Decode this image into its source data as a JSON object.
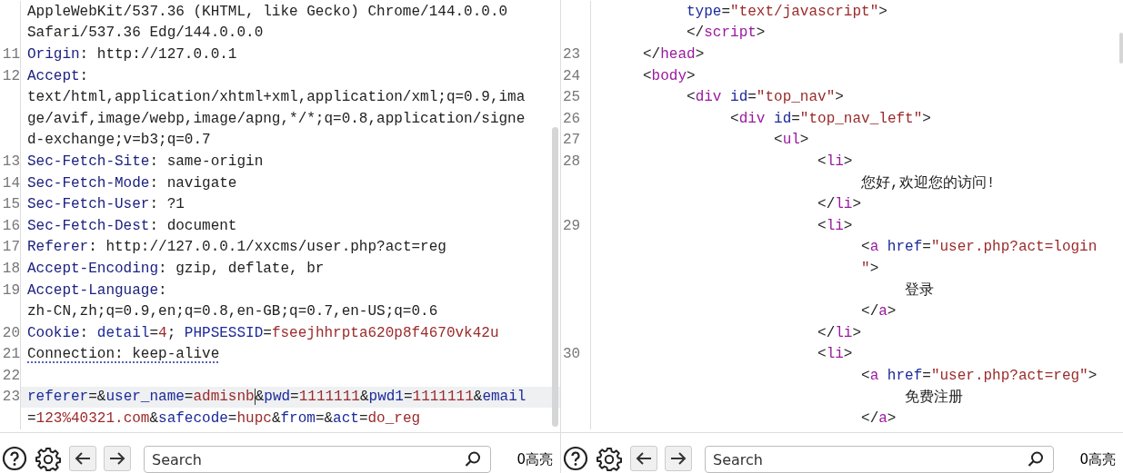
{
  "panes": [
    {
      "rows": [
        {
          "number": "",
          "current": false,
          "tokens": [
            {
              "kind": "plain",
              "text": "AppleWebKit/537.36 (KHTML, like Gecko) Chrome/144.0.0.0"
            }
          ]
        },
        {
          "number": "",
          "current": false,
          "tokens": [
            {
              "kind": "plain",
              "text": "Safari/537.36 Edg/144.0.0.0"
            }
          ]
        },
        {
          "number": "11",
          "current": false,
          "tokens": [
            {
              "kind": "name",
              "text": "Origin"
            },
            {
              "kind": "plain",
              "text": ": http://127.0.0.1"
            }
          ]
        },
        {
          "number": "12",
          "current": false,
          "tokens": [
            {
              "kind": "name",
              "text": "Accept"
            },
            {
              "kind": "plain",
              "text": ":"
            }
          ]
        },
        {
          "number": "",
          "current": false,
          "tokens": [
            {
              "kind": "plain",
              "text": "text/html,application/xhtml+xml,application/xml;q=0.9,ima"
            }
          ]
        },
        {
          "number": "",
          "current": false,
          "tokens": [
            {
              "kind": "plain",
              "text": "ge/avif,image/webp,image/apng,*/*;q=0.8,application/signe"
            }
          ]
        },
        {
          "number": "",
          "current": false,
          "tokens": [
            {
              "kind": "plain",
              "text": "d-exchange;v=b3;q=0.7"
            }
          ]
        },
        {
          "number": "13",
          "current": false,
          "tokens": [
            {
              "kind": "name",
              "text": "Sec-Fetch-Site"
            },
            {
              "kind": "plain",
              "text": ": same-origin"
            }
          ]
        },
        {
          "number": "14",
          "current": false,
          "tokens": [
            {
              "kind": "name",
              "text": "Sec-Fetch-Mode"
            },
            {
              "kind": "plain",
              "text": ": navigate"
            }
          ]
        },
        {
          "number": "15",
          "current": false,
          "tokens": [
            {
              "kind": "name",
              "text": "Sec-Fetch-User"
            },
            {
              "kind": "plain",
              "text": ": ?1"
            }
          ]
        },
        {
          "number": "16",
          "current": false,
          "tokens": [
            {
              "kind": "name",
              "text": "Sec-Fetch-Dest"
            },
            {
              "kind": "plain",
              "text": ": document"
            }
          ]
        },
        {
          "number": "17",
          "current": false,
          "tokens": [
            {
              "kind": "name",
              "text": "Referer"
            },
            {
              "kind": "plain",
              "text": ": http://127.0.0.1/xxcms/user.php?act=reg"
            }
          ]
        },
        {
          "number": "18",
          "current": false,
          "tokens": [
            {
              "kind": "name",
              "text": "Accept-Encoding"
            },
            {
              "kind": "plain",
              "text": ": gzip, deflate, br"
            }
          ]
        },
        {
          "number": "19",
          "current": false,
          "tokens": [
            {
              "kind": "name",
              "text": "Accept-Language"
            },
            {
              "kind": "plain",
              "text": ":"
            }
          ]
        },
        {
          "number": "",
          "current": false,
          "tokens": [
            {
              "kind": "plain",
              "text": "zh-CN,zh;q=0.9,en;q=0.8,en-GB;q=0.7,en-US;q=0.6"
            }
          ]
        },
        {
          "number": "20",
          "current": false,
          "tokens": [
            {
              "kind": "name",
              "text": "Cookie"
            },
            {
              "kind": "plain",
              "text": ": "
            },
            {
              "kind": "attr",
              "text": "detail"
            },
            {
              "kind": "plain",
              "text": "="
            },
            {
              "kind": "value",
              "text": "4"
            },
            {
              "kind": "plain",
              "text": "; "
            },
            {
              "kind": "attr",
              "text": "PHPSESSID"
            },
            {
              "kind": "plain",
              "text": "="
            },
            {
              "kind": "value",
              "text": "fseejhhrpta620p8f4670vk42u"
            }
          ]
        },
        {
          "number": "21",
          "current": false,
          "tokens": [
            {
              "kind": "warn",
              "text": "Connection: keep-alive"
            }
          ]
        },
        {
          "number": "22",
          "current": false,
          "tokens": []
        },
        {
          "number": "23",
          "current": true,
          "tokens": [
            {
              "kind": "attr",
              "text": "referer"
            },
            {
              "kind": "plain",
              "text": "=&"
            },
            {
              "kind": "attr",
              "text": "user_name"
            },
            {
              "kind": "plain",
              "text": "="
            },
            {
              "kind": "value",
              "text": "admisnb"
            },
            {
              "kind": "caret"
            },
            {
              "kind": "plain",
              "text": "&"
            },
            {
              "kind": "attr",
              "text": "pwd"
            },
            {
              "kind": "plain",
              "text": "="
            },
            {
              "kind": "value",
              "text": "1111111"
            },
            {
              "kind": "plain",
              "text": "&"
            },
            {
              "kind": "attr",
              "text": "pwd1"
            },
            {
              "kind": "plain",
              "text": "="
            },
            {
              "kind": "value",
              "text": "1111111"
            },
            {
              "kind": "plain",
              "text": "&"
            },
            {
              "kind": "attr",
              "text": "email"
            }
          ]
        },
        {
          "number": "",
          "current": false,
          "tokens": [
            {
              "kind": "plain",
              "text": "="
            },
            {
              "kind": "value",
              "text": "123%40321.com"
            },
            {
              "kind": "plain",
              "text": "&"
            },
            {
              "kind": "attr",
              "text": "safecode"
            },
            {
              "kind": "plain",
              "text": "="
            },
            {
              "kind": "value",
              "text": "hupc"
            },
            {
              "kind": "plain",
              "text": "&"
            },
            {
              "kind": "attr",
              "text": "from"
            },
            {
              "kind": "plain",
              "text": "=&"
            },
            {
              "kind": "attr",
              "text": "act"
            },
            {
              "kind": "plain",
              "text": "="
            },
            {
              "kind": "value",
              "text": "do_reg"
            }
          ]
        }
      ],
      "footer": {
        "search_placeholder": "Search",
        "highlights": "0高亮"
      }
    },
    {
      "rows": [
        {
          "number": "",
          "current": false,
          "tokens": [
            {
              "kind": "attr",
              "text": "          type"
            },
            {
              "kind": "plain",
              "text": "="
            },
            {
              "kind": "value",
              "text": "\"text/javascript\""
            },
            {
              "kind": "plain",
              "text": ">"
            }
          ]
        },
        {
          "number": "",
          "current": false,
          "tokens": [
            {
              "kind": "plain",
              "text": "          </"
            },
            {
              "kind": "tag",
              "text": "script"
            },
            {
              "kind": "plain",
              "text": ">"
            }
          ]
        },
        {
          "number": "23",
          "current": false,
          "tokens": [
            {
              "kind": "plain",
              "text": "     </"
            },
            {
              "kind": "tag",
              "text": "head"
            },
            {
              "kind": "plain",
              "text": ">"
            }
          ]
        },
        {
          "number": "24",
          "current": false,
          "tokens": [
            {
              "kind": "plain",
              "text": "     <"
            },
            {
              "kind": "tag",
              "text": "body"
            },
            {
              "kind": "plain",
              "text": ">"
            }
          ]
        },
        {
          "number": "25",
          "current": false,
          "tokens": [
            {
              "kind": "plain",
              "text": "          <"
            },
            {
              "kind": "tag",
              "text": "div"
            },
            {
              "kind": "attr",
              "text": " id"
            },
            {
              "kind": "plain",
              "text": "="
            },
            {
              "kind": "value",
              "text": "\"top_nav\""
            },
            {
              "kind": "plain",
              "text": ">"
            }
          ]
        },
        {
          "number": "26",
          "current": false,
          "tokens": [
            {
              "kind": "plain",
              "text": "               <"
            },
            {
              "kind": "tag",
              "text": "div"
            },
            {
              "kind": "attr",
              "text": " id"
            },
            {
              "kind": "plain",
              "text": "="
            },
            {
              "kind": "value",
              "text": "\"top_nav_left\""
            },
            {
              "kind": "plain",
              "text": ">"
            }
          ]
        },
        {
          "number": "27",
          "current": false,
          "tokens": [
            {
              "kind": "plain",
              "text": "                    <"
            },
            {
              "kind": "tag",
              "text": "ul"
            },
            {
              "kind": "plain",
              "text": ">"
            }
          ]
        },
        {
          "number": "28",
          "current": false,
          "tokens": [
            {
              "kind": "plain",
              "text": "                         <"
            },
            {
              "kind": "tag",
              "text": "li"
            },
            {
              "kind": "plain",
              "text": ">"
            }
          ]
        },
        {
          "number": "",
          "current": false,
          "tokens": [
            {
              "kind": "plain",
              "text": "                              您好,欢迎您的访问!"
            }
          ]
        },
        {
          "number": "",
          "current": false,
          "tokens": [
            {
              "kind": "plain",
              "text": "                         </"
            },
            {
              "kind": "tag",
              "text": "li"
            },
            {
              "kind": "plain",
              "text": ">"
            }
          ]
        },
        {
          "number": "29",
          "current": false,
          "tokens": [
            {
              "kind": "plain",
              "text": "                         <"
            },
            {
              "kind": "tag",
              "text": "li"
            },
            {
              "kind": "plain",
              "text": ">"
            }
          ]
        },
        {
          "number": "",
          "current": false,
          "tokens": [
            {
              "kind": "plain",
              "text": "                              <"
            },
            {
              "kind": "tag",
              "text": "a"
            },
            {
              "kind": "attr",
              "text": " href"
            },
            {
              "kind": "plain",
              "text": "="
            },
            {
              "kind": "value",
              "text": "\"user.php?act=login"
            }
          ]
        },
        {
          "number": "",
          "current": false,
          "tokens": [
            {
              "kind": "value",
              "text": "                              \""
            },
            {
              "kind": "plain",
              "text": ">"
            }
          ]
        },
        {
          "number": "",
          "current": false,
          "tokens": [
            {
              "kind": "plain",
              "text": "                                   登录"
            }
          ]
        },
        {
          "number": "",
          "current": false,
          "tokens": [
            {
              "kind": "plain",
              "text": "                              </"
            },
            {
              "kind": "tag",
              "text": "a"
            },
            {
              "kind": "plain",
              "text": ">"
            }
          ]
        },
        {
          "number": "",
          "current": false,
          "tokens": [
            {
              "kind": "plain",
              "text": "                         </"
            },
            {
              "kind": "tag",
              "text": "li"
            },
            {
              "kind": "plain",
              "text": ">"
            }
          ]
        },
        {
          "number": "30",
          "current": false,
          "tokens": [
            {
              "kind": "plain",
              "text": "                         <"
            },
            {
              "kind": "tag",
              "text": "li"
            },
            {
              "kind": "plain",
              "text": ">"
            }
          ]
        },
        {
          "number": "",
          "current": false,
          "tokens": [
            {
              "kind": "plain",
              "text": "                              <"
            },
            {
              "kind": "tag",
              "text": "a"
            },
            {
              "kind": "attr",
              "text": " href"
            },
            {
              "kind": "plain",
              "text": "="
            },
            {
              "kind": "value",
              "text": "\"user.php?act=reg\""
            },
            {
              "kind": "plain",
              "text": ">"
            }
          ]
        },
        {
          "number": "",
          "current": false,
          "tokens": [
            {
              "kind": "plain",
              "text": "                                   免费注册"
            }
          ]
        },
        {
          "number": "",
          "current": false,
          "tokens": [
            {
              "kind": "plain",
              "text": "                              </"
            },
            {
              "kind": "tag",
              "text": "a"
            },
            {
              "kind": "plain",
              "text": ">"
            }
          ]
        }
      ],
      "footer": {
        "search_placeholder": "Search",
        "highlights": "0高亮"
      }
    }
  ]
}
